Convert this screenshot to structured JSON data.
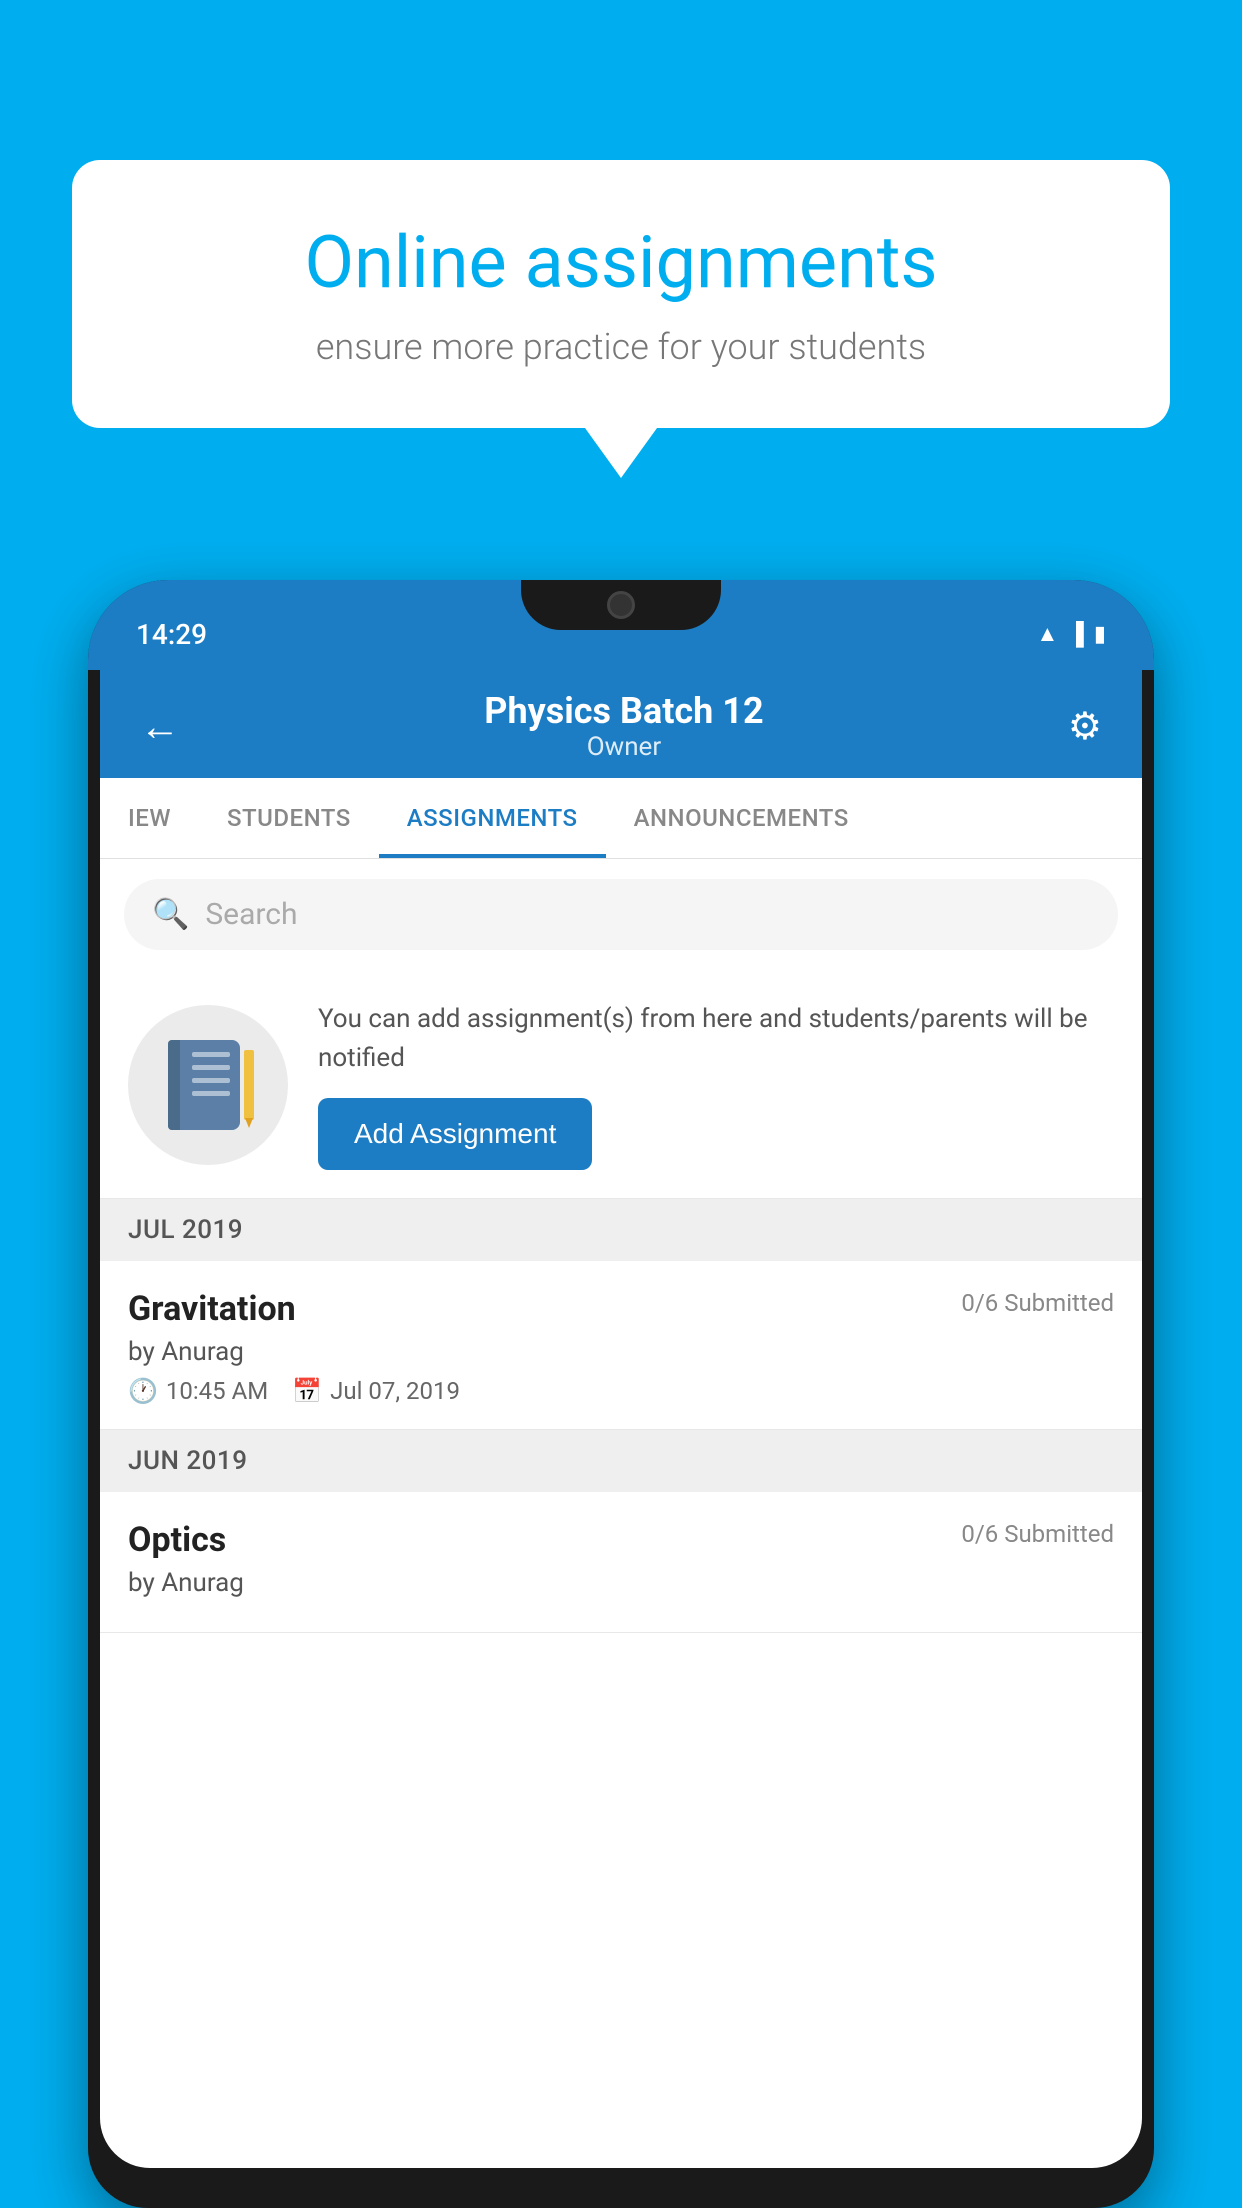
{
  "background_color": "#00AEEF",
  "speech_bubble": {
    "title": "Online assignments",
    "subtitle": "ensure more practice for your students"
  },
  "phone": {
    "status_bar": {
      "time": "14:29"
    },
    "header": {
      "title": "Physics Batch 12",
      "subtitle": "Owner",
      "back_label": "←",
      "settings_label": "⚙"
    },
    "tabs": [
      {
        "label": "IEW",
        "active": false
      },
      {
        "label": "STUDENTS",
        "active": false
      },
      {
        "label": "ASSIGNMENTS",
        "active": true
      },
      {
        "label": "ANNOUNCEMENTS",
        "active": false
      }
    ],
    "search": {
      "placeholder": "Search"
    },
    "assignment_prompt": {
      "info_text": "You can add assignment(s) from here and students/parents will be notified",
      "button_label": "Add Assignment"
    },
    "sections": [
      {
        "month_label": "JUL 2019",
        "items": [
          {
            "name": "Gravitation",
            "submitted": "0/6 Submitted",
            "by": "by Anurag",
            "time": "10:45 AM",
            "date": "Jul 07, 2019"
          }
        ]
      },
      {
        "month_label": "JUN 2019",
        "items": [
          {
            "name": "Optics",
            "submitted": "0/6 Submitted",
            "by": "by Anurag",
            "time": "",
            "date": ""
          }
        ]
      }
    ]
  }
}
